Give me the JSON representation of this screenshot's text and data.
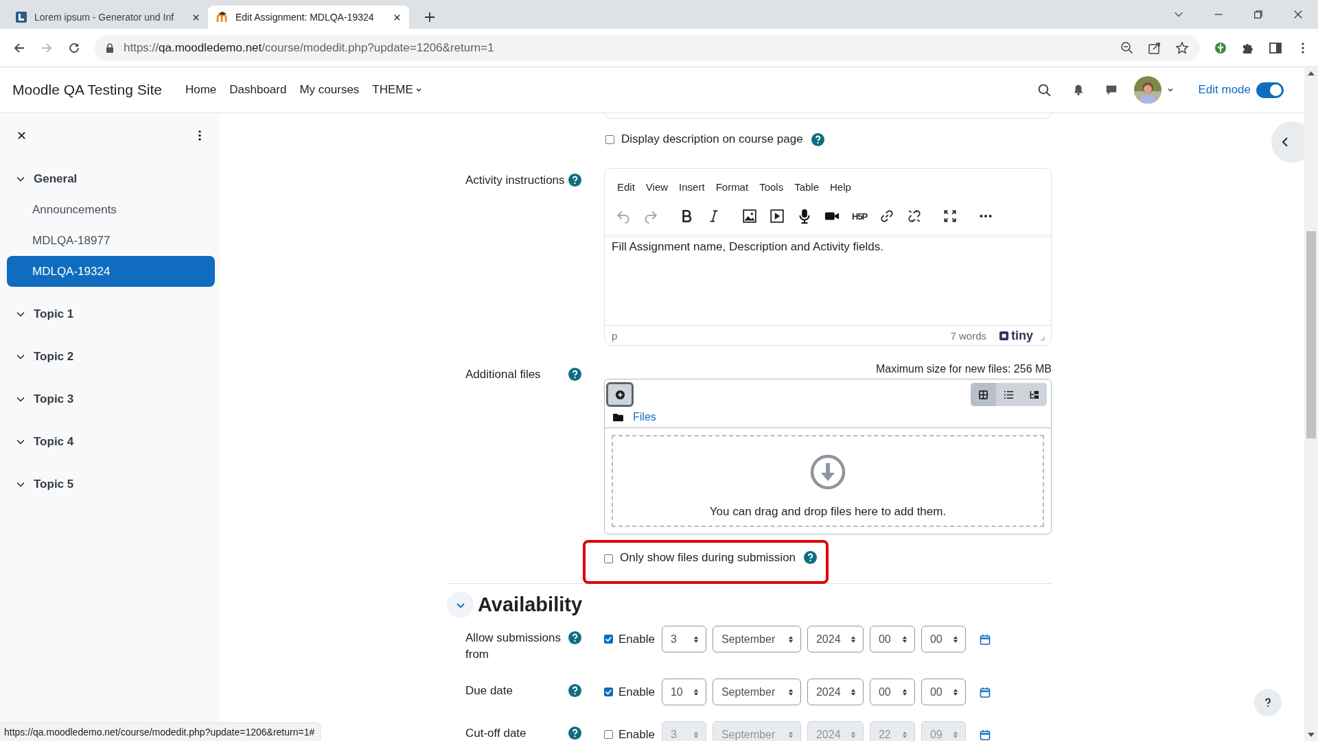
{
  "browser": {
    "tabs": [
      {
        "title": "Lorem ipsum - Generator und Inf",
        "selected": false,
        "kind": "lorem"
      },
      {
        "title": "Edit Assignment: MDLQA-19324",
        "selected": true,
        "kind": "moodle"
      }
    ],
    "forward_enabled": false,
    "url": {
      "scheme": "https://",
      "host": "qa.moodledemo.net",
      "path": "/course/modedit.php?update=1206&return=1"
    }
  },
  "navbar": {
    "site_name": "Moodle QA Testing Site",
    "links": [
      {
        "label": "Home",
        "kind": "link"
      },
      {
        "label": "Dashboard",
        "kind": "link"
      },
      {
        "label": "My courses",
        "kind": "link"
      },
      {
        "label": "THEME",
        "kind": "dropdown"
      }
    ],
    "edit_mode": {
      "label": "Edit mode",
      "on": true
    }
  },
  "course_index": {
    "sections": [
      {
        "title": "General",
        "expanded": true,
        "children": [
          {
            "label": "Announcements",
            "selected": false
          },
          {
            "label": "MDLQA-18977",
            "selected": false
          },
          {
            "label": "MDLQA-19324",
            "selected": true
          }
        ]
      },
      {
        "title": "Topic 1",
        "expanded": true
      },
      {
        "title": "Topic 2",
        "expanded": true
      },
      {
        "title": "Topic 3",
        "expanded": true
      },
      {
        "title": "Topic 4",
        "expanded": true
      },
      {
        "title": "Topic 5",
        "expanded": true
      }
    ]
  },
  "form": {
    "display_description": {
      "label": "Display description on course page",
      "checked": false
    },
    "activity_instructions": {
      "label": "Activity instructions",
      "menu": [
        "Edit",
        "View",
        "Insert",
        "Format",
        "Tools",
        "Table",
        "Help"
      ],
      "undo_enabled": false,
      "redo_enabled": false,
      "h5p_label": "H5P",
      "content": "Fill Assignment name, Description and Activity fields.",
      "element_path": "p",
      "word_count": "7 words",
      "brand": "tiny"
    },
    "additional_files": {
      "label": "Additional files",
      "max_size": "Maximum size for new files: 256 MB",
      "path": "Files",
      "view_modes": [
        {
          "kind": "grid",
          "selected": true
        },
        {
          "kind": "list",
          "selected": false
        },
        {
          "kind": "tree",
          "selected": false
        }
      ],
      "drop_hint": "You can drag and drop files here to add them."
    },
    "only_show_files": {
      "label": "Only show files during submission",
      "checked": false,
      "highlighted": true
    }
  },
  "availability": {
    "title": "Availability",
    "expanded": true,
    "rows": [
      {
        "label": "Allow submissions from",
        "enable_label": "Enable",
        "checked": true,
        "day": "3",
        "month": "September",
        "year": "2024",
        "hour": "00",
        "minute": "00"
      },
      {
        "label": "Due date",
        "enable_label": "Enable",
        "checked": true,
        "day": "10",
        "month": "September",
        "year": "2024",
        "hour": "00",
        "minute": "00"
      },
      {
        "label": "Cut-off date",
        "enable_label": "Enable",
        "checked": false,
        "day": "3",
        "month": "September",
        "year": "2024",
        "hour": "22",
        "minute": "09"
      }
    ]
  },
  "status_url": "https://qa.moodledemo.net/course/modedit.php?update=1206&return=1#"
}
